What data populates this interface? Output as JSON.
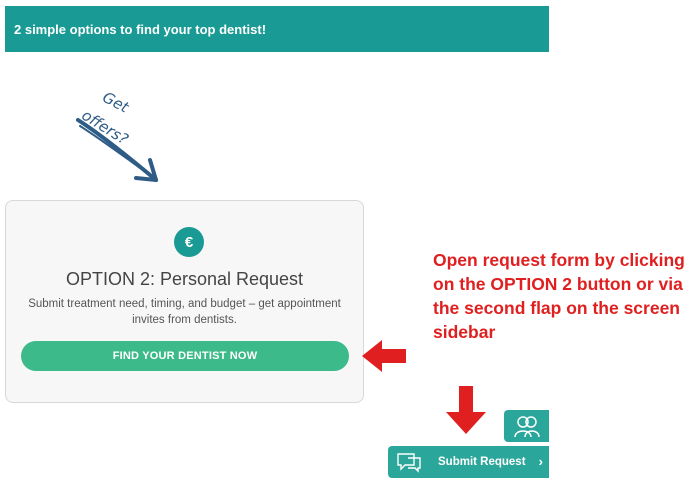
{
  "banner": {
    "text": "2 simple options to find your top dentist!"
  },
  "doodle": {
    "line1": "Get",
    "line2": "offers?"
  },
  "card": {
    "icon": "€",
    "title": "OPTION 2: Personal Request",
    "description": "Submit treatment need, timing, and budget – get appointment invites from dentists.",
    "button_label": "FIND YOUR DENTIST NOW"
  },
  "annotation": {
    "text": "Open request form by clicking on the OPTION 2 button or via the second flap on the screen sidebar"
  },
  "sidebar": {
    "avatar_icon": "dentist-avatar-icon",
    "submit_icon": "chat-bubble-icon",
    "submit_label": "Submit Request",
    "chevron": "›"
  },
  "colors": {
    "banner": "#1a9a94",
    "button": "#3dba89",
    "annotation": "#e02020",
    "sidebar_tab": "#2aa79a",
    "doodle": "#2e5c86"
  }
}
